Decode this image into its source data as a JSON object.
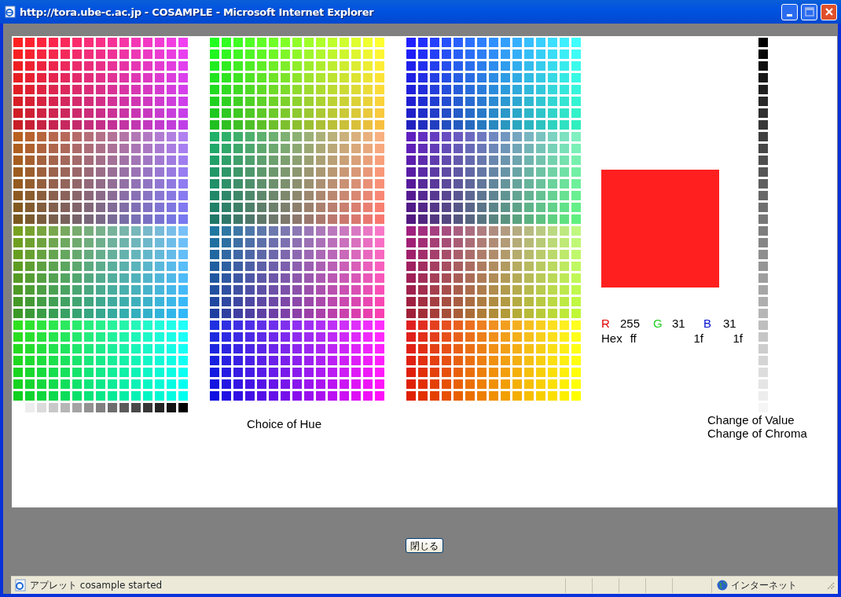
{
  "window": {
    "title": "http://tora.ube-c.ac.jp - COSAMPLE - Microsoft Internet Explorer"
  },
  "applet": {
    "hue_label": "Choice of Hue",
    "readout": {
      "r_label": "R",
      "r_value": "255",
      "g_label": "G",
      "g_value": "31",
      "b_label": "B",
      "b_value": "31",
      "hex_label": "Hex",
      "r_hex": "ff",
      "g_hex": "1f",
      "b_hex": "1f"
    },
    "value_label": "Change of Value",
    "chroma_label": "Change of Chroma"
  },
  "close_button": "閉じる",
  "status_bar": {
    "message": "アプレット cosample started",
    "zone": "インターネット"
  }
}
